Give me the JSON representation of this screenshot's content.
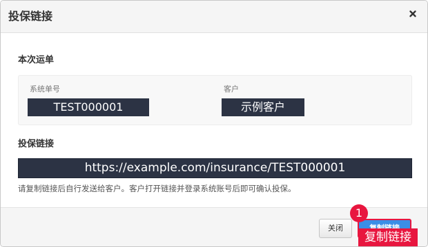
{
  "dialog": {
    "title": "投保链接",
    "close_glyph": "×"
  },
  "waybill_section": {
    "title": "本次运单",
    "system_waybill_no": {
      "label": "系统单号",
      "value": "TEST000001"
    },
    "customer": {
      "label": "客户",
      "value": "示例客户"
    }
  },
  "link_section": {
    "title": "投保链接",
    "url": "https://example.com/insurance/TEST000001",
    "hint": "请复制链接后自行发送给客户。客户打开链接并登录系统账号后即可确认投保。"
  },
  "footer": {
    "close_label": "关闭",
    "copy_label": "复制链接"
  },
  "annotation": {
    "step_number": "1",
    "step_label": "复制链接"
  },
  "colors": {
    "redacted_fill": "#2c3344",
    "primary_button": "#3a8ee6",
    "annotation_red": "#e8163f"
  },
  "icons": {
    "close": "close-icon"
  }
}
